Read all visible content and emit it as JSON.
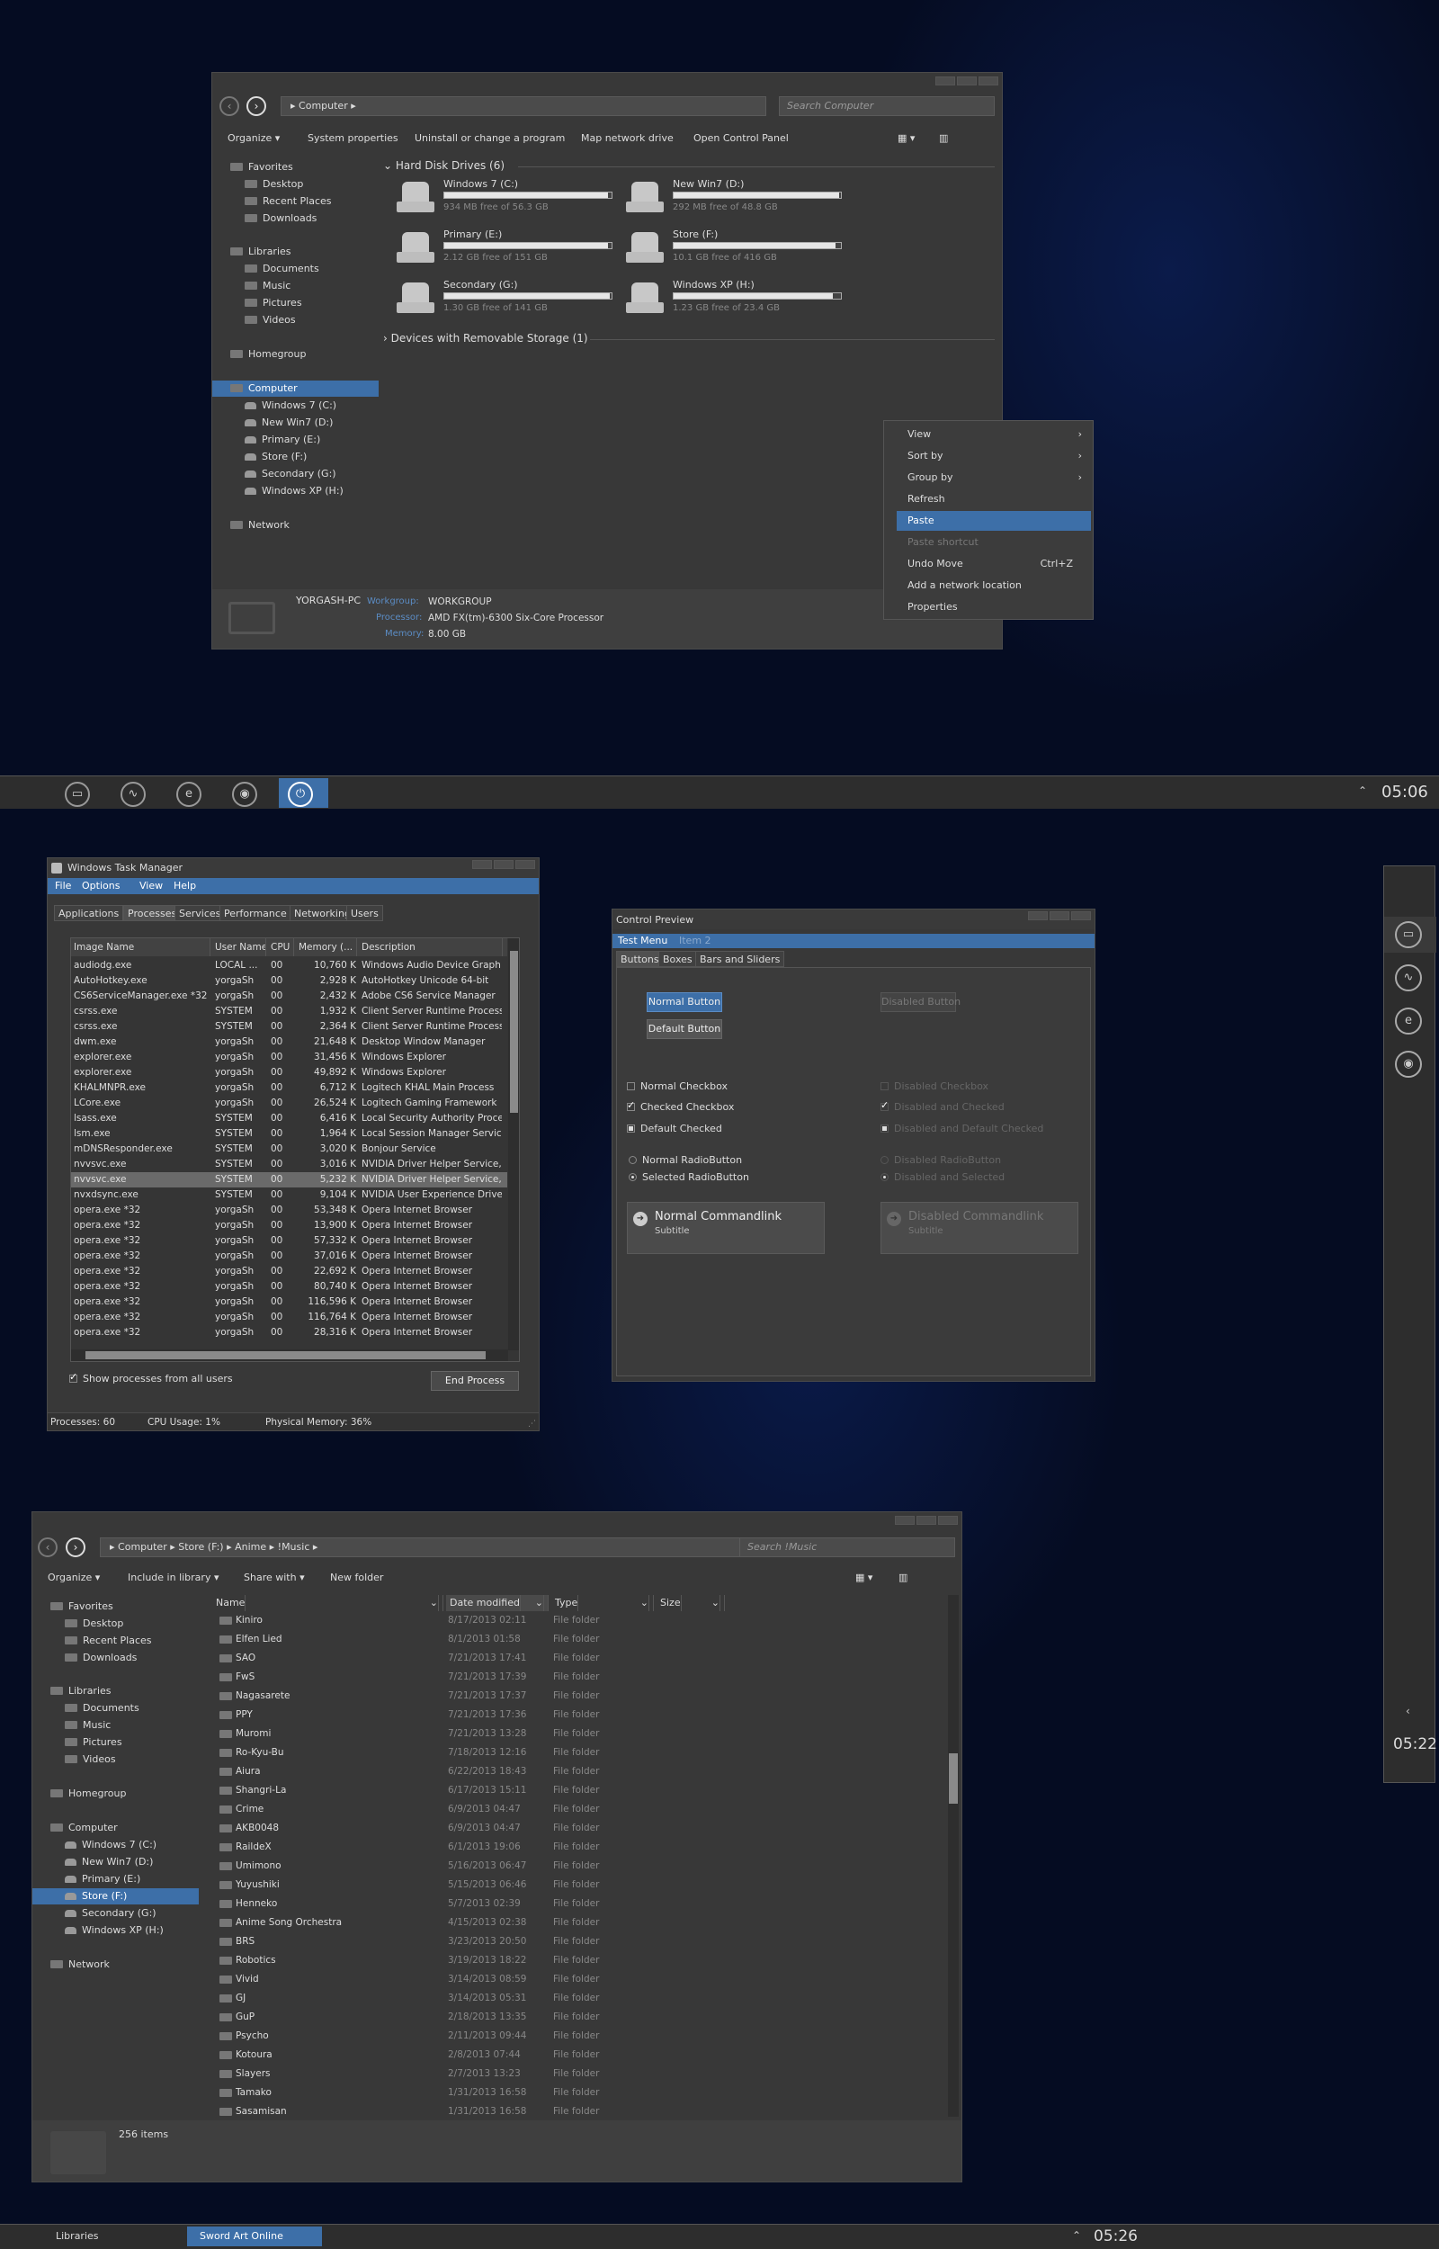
{
  "colors": {
    "accent": "#3d6fa8",
    "window_bg": "#383838",
    "desktop_bg": "#050c22"
  },
  "explorer1": {
    "address": "Computer",
    "search_placeholder": "Search Computer",
    "toolbar": {
      "organize": "Organize",
      "system_properties": "System properties",
      "uninstall": "Uninstall or change a program",
      "map_drive": "Map network drive",
      "control_panel": "Open Control Panel"
    },
    "nav": {
      "favorites": "Favorites",
      "desktop": "Desktop",
      "recent": "Recent Places",
      "downloads": "Downloads",
      "libraries": "Libraries",
      "documents": "Documents",
      "music": "Music",
      "pictures": "Pictures",
      "videos": "Videos",
      "homegroup": "Homegroup",
      "computer": "Computer",
      "drives": [
        "Windows 7 (C:)",
        "New Win7 (D:)",
        "Primary (E:)",
        "Store (F:)",
        "Secondary (G:)",
        "Windows XP (H:)"
      ],
      "network": "Network"
    },
    "section_hdd": "Hard Disk Drives (6)",
    "section_removable": "Devices with Removable Storage (1)",
    "drives": [
      {
        "name": "Windows 7 (C:)",
        "free": "934 MB free of 56.3 GB",
        "used_fraction": 0.98
      },
      {
        "name": "New Win7 (D:)",
        "free": "292 MB free of 48.8 GB",
        "used_fraction": 0.99
      },
      {
        "name": "Primary (E:)",
        "free": "2.12 GB free of 151 GB",
        "used_fraction": 0.98
      },
      {
        "name": "Store (F:)",
        "free": "10.1 GB free of 416 GB",
        "used_fraction": 0.97
      },
      {
        "name": "Secondary (G:)",
        "free": "1.30 GB free of 141 GB",
        "used_fraction": 0.99
      },
      {
        "name": "Windows XP (H:)",
        "free": "1.23 GB free of 23.4 GB",
        "used_fraction": 0.95
      }
    ],
    "details": {
      "pc_name": "YORGASH-PC",
      "workgroup_label": "Workgroup:",
      "workgroup": "WORKGROUP",
      "processor_label": "Processor:",
      "processor": "AMD FX(tm)-6300 Six-Core Processor",
      "memory_label": "Memory:",
      "memory": "8.00 GB"
    },
    "context_menu": [
      {
        "label": "View",
        "submenu": true
      },
      {
        "label": "Sort by",
        "submenu": true
      },
      {
        "label": "Group by",
        "submenu": true
      },
      {
        "label": "Refresh"
      },
      {
        "label": "Paste",
        "highlighted": true
      },
      {
        "label": "Paste shortcut",
        "disabled": true
      },
      {
        "label": "Undo Move",
        "shortcut": "Ctrl+Z"
      },
      {
        "label": "Add a network location"
      },
      {
        "label": "Properties"
      }
    ]
  },
  "taskbar1": {
    "clock": "05:06"
  },
  "task_manager": {
    "title": "Windows Task Manager",
    "menu": [
      "File",
      "Options",
      "View",
      "Help"
    ],
    "tabs": [
      "Applications",
      "Processes",
      "Services",
      "Performance",
      "Networking",
      "Users"
    ],
    "columns": [
      "Image Name",
      "User Name",
      "CPU",
      "Memory (...",
      "Description"
    ],
    "rows": [
      [
        "audiodg.exe",
        "LOCAL ...",
        "00",
        "10,760 K",
        "Windows Audio Device Graph I..."
      ],
      [
        "AutoHotkey.exe",
        "yorgaSh",
        "00",
        "2,928 K",
        "AutoHotkey Unicode 64-bit"
      ],
      [
        "CS6ServiceManager.exe *32",
        "yorgaSh",
        "00",
        "2,432 K",
        "Adobe CS6 Service Manager"
      ],
      [
        "csrss.exe",
        "SYSTEM",
        "00",
        "1,932 K",
        "Client Server Runtime Process"
      ],
      [
        "csrss.exe",
        "SYSTEM",
        "00",
        "2,364 K",
        "Client Server Runtime Process"
      ],
      [
        "dwm.exe",
        "yorgaSh",
        "00",
        "21,648 K",
        "Desktop Window Manager"
      ],
      [
        "explorer.exe",
        "yorgaSh",
        "00",
        "31,456 K",
        "Windows Explorer"
      ],
      [
        "explorer.exe",
        "yorgaSh",
        "00",
        "49,892 K",
        "Windows Explorer"
      ],
      [
        "KHALMNPR.exe",
        "yorgaSh",
        "00",
        "6,712 K",
        "Logitech KHAL Main Process"
      ],
      [
        "LCore.exe",
        "yorgaSh",
        "00",
        "26,524 K",
        "Logitech Gaming Framework"
      ],
      [
        "lsass.exe",
        "SYSTEM",
        "00",
        "6,416 K",
        "Local Security Authority Process"
      ],
      [
        "lsm.exe",
        "SYSTEM",
        "00",
        "1,964 K",
        "Local Session Manager Service"
      ],
      [
        "mDNSResponder.exe",
        "SYSTEM",
        "00",
        "3,020 K",
        "Bonjour Service"
      ],
      [
        "nvvsvc.exe",
        "SYSTEM",
        "00",
        "3,016 K",
        "NVIDIA Driver Helper Service, V..."
      ],
      [
        "nvvsvc.exe",
        "SYSTEM",
        "00",
        "5,232 K",
        "NVIDIA Driver Helper Service, V..."
      ],
      [
        "nvxdsync.exe",
        "SYSTEM",
        "00",
        "9,104 K",
        "NVIDIA User Experience Driver..."
      ],
      [
        "opera.exe *32",
        "yorgaSh",
        "00",
        "53,348 K",
        "Opera Internet Browser"
      ],
      [
        "opera.exe *32",
        "yorgaSh",
        "00",
        "13,900 K",
        "Opera Internet Browser"
      ],
      [
        "opera.exe *32",
        "yorgaSh",
        "00",
        "57,332 K",
        "Opera Internet Browser"
      ],
      [
        "opera.exe *32",
        "yorgaSh",
        "00",
        "37,016 K",
        "Opera Internet Browser"
      ],
      [
        "opera.exe *32",
        "yorgaSh",
        "00",
        "22,692 K",
        "Opera Internet Browser"
      ],
      [
        "opera.exe *32",
        "yorgaSh",
        "00",
        "80,740 K",
        "Opera Internet Browser"
      ],
      [
        "opera.exe *32",
        "yorgaSh",
        "00",
        "116,596 K",
        "Opera Internet Browser"
      ],
      [
        "opera.exe *32",
        "yorgaSh",
        "00",
        "116,764 K",
        "Opera Internet Browser"
      ],
      [
        "opera.exe *32",
        "yorgaSh",
        "00",
        "28,316 K",
        "Opera Internet Browser"
      ]
    ],
    "selected_row": 14,
    "show_all_label": "Show processes from all users",
    "end_process": "End Process",
    "status": {
      "processes": "Processes: 60",
      "cpu": "CPU Usage: 1%",
      "memory": "Physical Memory: 36%"
    }
  },
  "control_preview": {
    "title": "Control Preview",
    "menu": [
      "Test Menu",
      "Item 2"
    ],
    "tabs": [
      "Buttons",
      "Boxes",
      "Bars and Sliders"
    ],
    "normal_button": "Normal Button",
    "default_button": "Default Button",
    "disabled_button": "Disabled Button",
    "normal_checkbox": "Normal Checkbox",
    "checked_checkbox": "Checked Checkbox",
    "default_checked": "Default Checked",
    "disabled_checkbox": "Disabled Checkbox",
    "disabled_checked": "Disabled and Checked",
    "disabled_default_checked": "Disabled and Default Checked",
    "normal_radio": "Normal RadioButton",
    "selected_radio": "Selected RadioButton",
    "disabled_radio": "Disabled RadioButton",
    "disabled_selected": "Disabled and Selected",
    "normal_cmdlink": "Normal Commandlink",
    "disabled_cmdlink": "Disabled Commandlink",
    "subtitle": "Subtitle"
  },
  "sidebar_clock": "05:22",
  "explorer2": {
    "breadcrumb": [
      "Computer",
      "Store (F:)",
      "Anime",
      "!Music"
    ],
    "search_placeholder": "Search !Music",
    "toolbar": {
      "organize": "Organize",
      "include": "Include in library",
      "share": "Share with",
      "new_folder": "New folder"
    },
    "nav": {
      "favorites": "Favorites",
      "desktop": "Desktop",
      "recent": "Recent Places",
      "downloads": "Downloads",
      "libraries": "Libraries",
      "documents": "Documents",
      "music": "Music",
      "pictures": "Pictures",
      "videos": "Videos",
      "homegroup": "Homegroup",
      "computer": "Computer",
      "drives": [
        "Windows 7 (C:)",
        "New Win7 (D:)",
        "Primary (E:)",
        "Store (F:)",
        "Secondary (G:)",
        "Windows XP (H:)"
      ],
      "network": "Network"
    },
    "columns": [
      "Name",
      "Date modified",
      "Type",
      "Size"
    ],
    "files": [
      [
        "Kiniro",
        "8/17/2013 02:11",
        "File folder"
      ],
      [
        "Elfen Lied",
        "8/1/2013 01:58",
        "File folder"
      ],
      [
        "SAO",
        "7/21/2013 17:41",
        "File folder"
      ],
      [
        "FwS",
        "7/21/2013 17:39",
        "File folder"
      ],
      [
        "Nagasarete",
        "7/21/2013 17:37",
        "File folder"
      ],
      [
        "PPY",
        "7/21/2013 17:36",
        "File folder"
      ],
      [
        "Muromi",
        "7/21/2013 13:28",
        "File folder"
      ],
      [
        "Ro-Kyu-Bu",
        "7/18/2013 12:16",
        "File folder"
      ],
      [
        "Aiura",
        "6/22/2013 18:43",
        "File folder"
      ],
      [
        "Shangri-La",
        "6/17/2013 15:11",
        "File folder"
      ],
      [
        "Crime",
        "6/9/2013 04:47",
        "File folder"
      ],
      [
        "AKB0048",
        "6/9/2013 04:47",
        "File folder"
      ],
      [
        "RaildeX",
        "6/1/2013 19:06",
        "File folder"
      ],
      [
        "Umimono",
        "5/16/2013 06:47",
        "File folder"
      ],
      [
        "Yuyushiki",
        "5/15/2013 06:46",
        "File folder"
      ],
      [
        "Henneko",
        "5/7/2013 02:39",
        "File folder"
      ],
      [
        "Anime Song Orchestra",
        "4/15/2013 02:38",
        "File folder"
      ],
      [
        "BRS",
        "3/23/2013 20:50",
        "File folder"
      ],
      [
        "Robotics",
        "3/19/2013 18:22",
        "File folder"
      ],
      [
        "Vivid",
        "3/14/2013 08:59",
        "File folder"
      ],
      [
        "GJ",
        "3/14/2013 05:31",
        "File folder"
      ],
      [
        "GuP",
        "2/18/2013 13:35",
        "File folder"
      ],
      [
        "Psycho",
        "2/11/2013 09:44",
        "File folder"
      ],
      [
        "Kotoura",
        "2/8/2013 07:44",
        "File folder"
      ],
      [
        "Slayers",
        "2/7/2013 13:23",
        "File folder"
      ],
      [
        "Tamako",
        "1/31/2013 16:58",
        "File folder"
      ],
      [
        "Sasamisan",
        "1/31/2013 16:58",
        "File folder"
      ]
    ],
    "item_count": "256 items"
  },
  "taskbar2": {
    "libraries": "Libraries",
    "sao": "Sword Art Online",
    "clock": "05:26"
  },
  "icons": {
    "folder": "folder-icon",
    "activity": "activity-icon",
    "ie": "ie-icon",
    "media": "media-player-icon",
    "power": "power-icon"
  }
}
